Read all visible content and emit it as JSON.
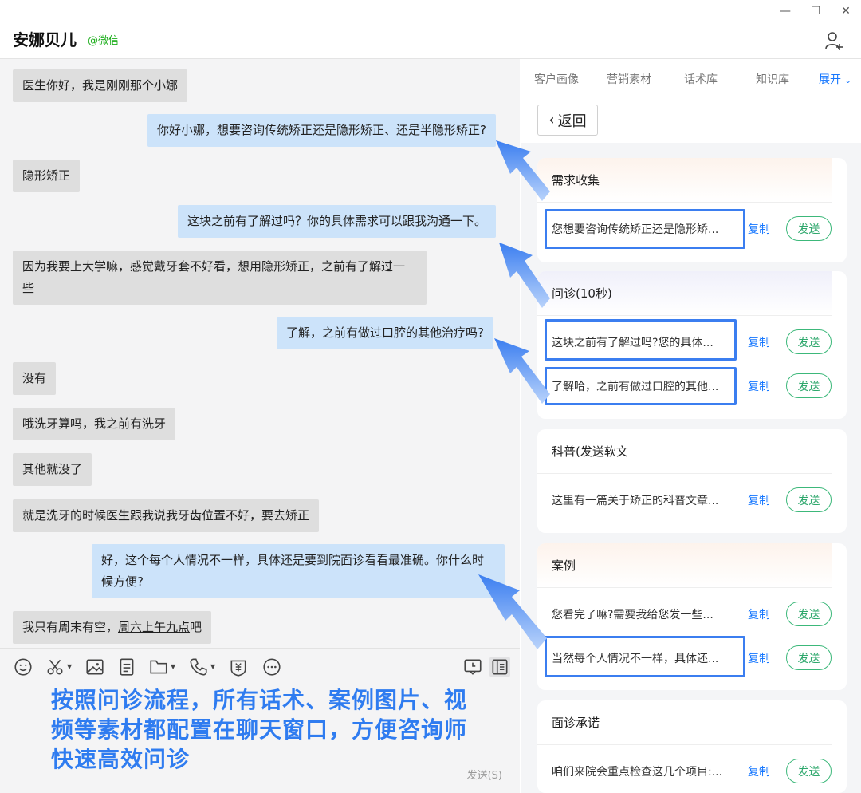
{
  "window": {
    "minimize": "—",
    "maximize": "☐",
    "close": "✕"
  },
  "header": {
    "contact_name": "安娜贝儿",
    "contact_tag": "@微信"
  },
  "messages": [
    {
      "side": "left",
      "text": "医生你好，我是刚刚那个小娜"
    },
    {
      "side": "right",
      "text": "你好小娜，想要咨询传统矫正还是隐形矫正、还是半隐形矫正?"
    },
    {
      "side": "left",
      "text": "隐形矫正"
    },
    {
      "side": "right",
      "text": "这块之前有了解过吗？你的具体需求可以跟我沟通一下。"
    },
    {
      "side": "left",
      "line1": "因为我要上大学嘛，感觉戴牙套不好看，想用隐形矫正，之前有了解过一",
      "line2": "些"
    },
    {
      "side": "right",
      "text": "了解，之前有做过口腔的其他治疗吗?"
    },
    {
      "side": "left",
      "text": "没有"
    },
    {
      "side": "left",
      "text": "哦洗牙算吗，我之前有洗牙"
    },
    {
      "side": "left",
      "text": "其他就没了"
    },
    {
      "side": "left",
      "text": "就是洗牙的时候医生跟我说我牙齿位置不好，要去矫正"
    },
    {
      "side": "right",
      "line1": "好，这个每个人情况不一样，具体还是要到院面诊看看最准确。你什么时",
      "line2": "候方便?"
    },
    {
      "side": "left",
      "prefix": "我只有周末有空，",
      "underlined": "周六上午九点",
      "suffix": "吧"
    }
  ],
  "tabs": [
    "客户画像",
    "营销素材",
    "话术库",
    "知识库"
  ],
  "tab_expand": "展开",
  "back_label": "返回",
  "cards": [
    {
      "title": "需求收集",
      "items": [
        "您想要咨询传统矫正还是隐形矫..."
      ]
    },
    {
      "title": "问诊(10秒)",
      "items": [
        "这块之前有了解过吗?您的具体...",
        "了解哈，之前有做过口腔的其他..."
      ]
    },
    {
      "title": "科普(发送软文",
      "items": [
        "这里有一篇关于矫正的科普文章..."
      ]
    },
    {
      "title": "案例",
      "items": [
        "您看完了嘛?需要我给您发一些...",
        "当然每个人情况不一样，具体还..."
      ]
    },
    {
      "title": "面诊承诺",
      "items": [
        "咱们来院会重点检查这几个项目:..."
      ]
    }
  ],
  "copy_label": "复制",
  "send_label": "发送",
  "composer": {
    "annotation_line1": "按照问诊流程，所有话术、案例图片、视",
    "annotation_line2": "频等素材都配置在聊天窗口，方便咨询师",
    "annotation_line3": "快速高效问诊",
    "send_button": "发送(S)"
  },
  "colors": {
    "accent": "#1677ff",
    "annotation": "#2f7cf0",
    "highlight": "#3b7ef0",
    "send_green": "#2fa86d",
    "bubble_right": "#cce3fa",
    "bubble_left": "#dedede"
  }
}
